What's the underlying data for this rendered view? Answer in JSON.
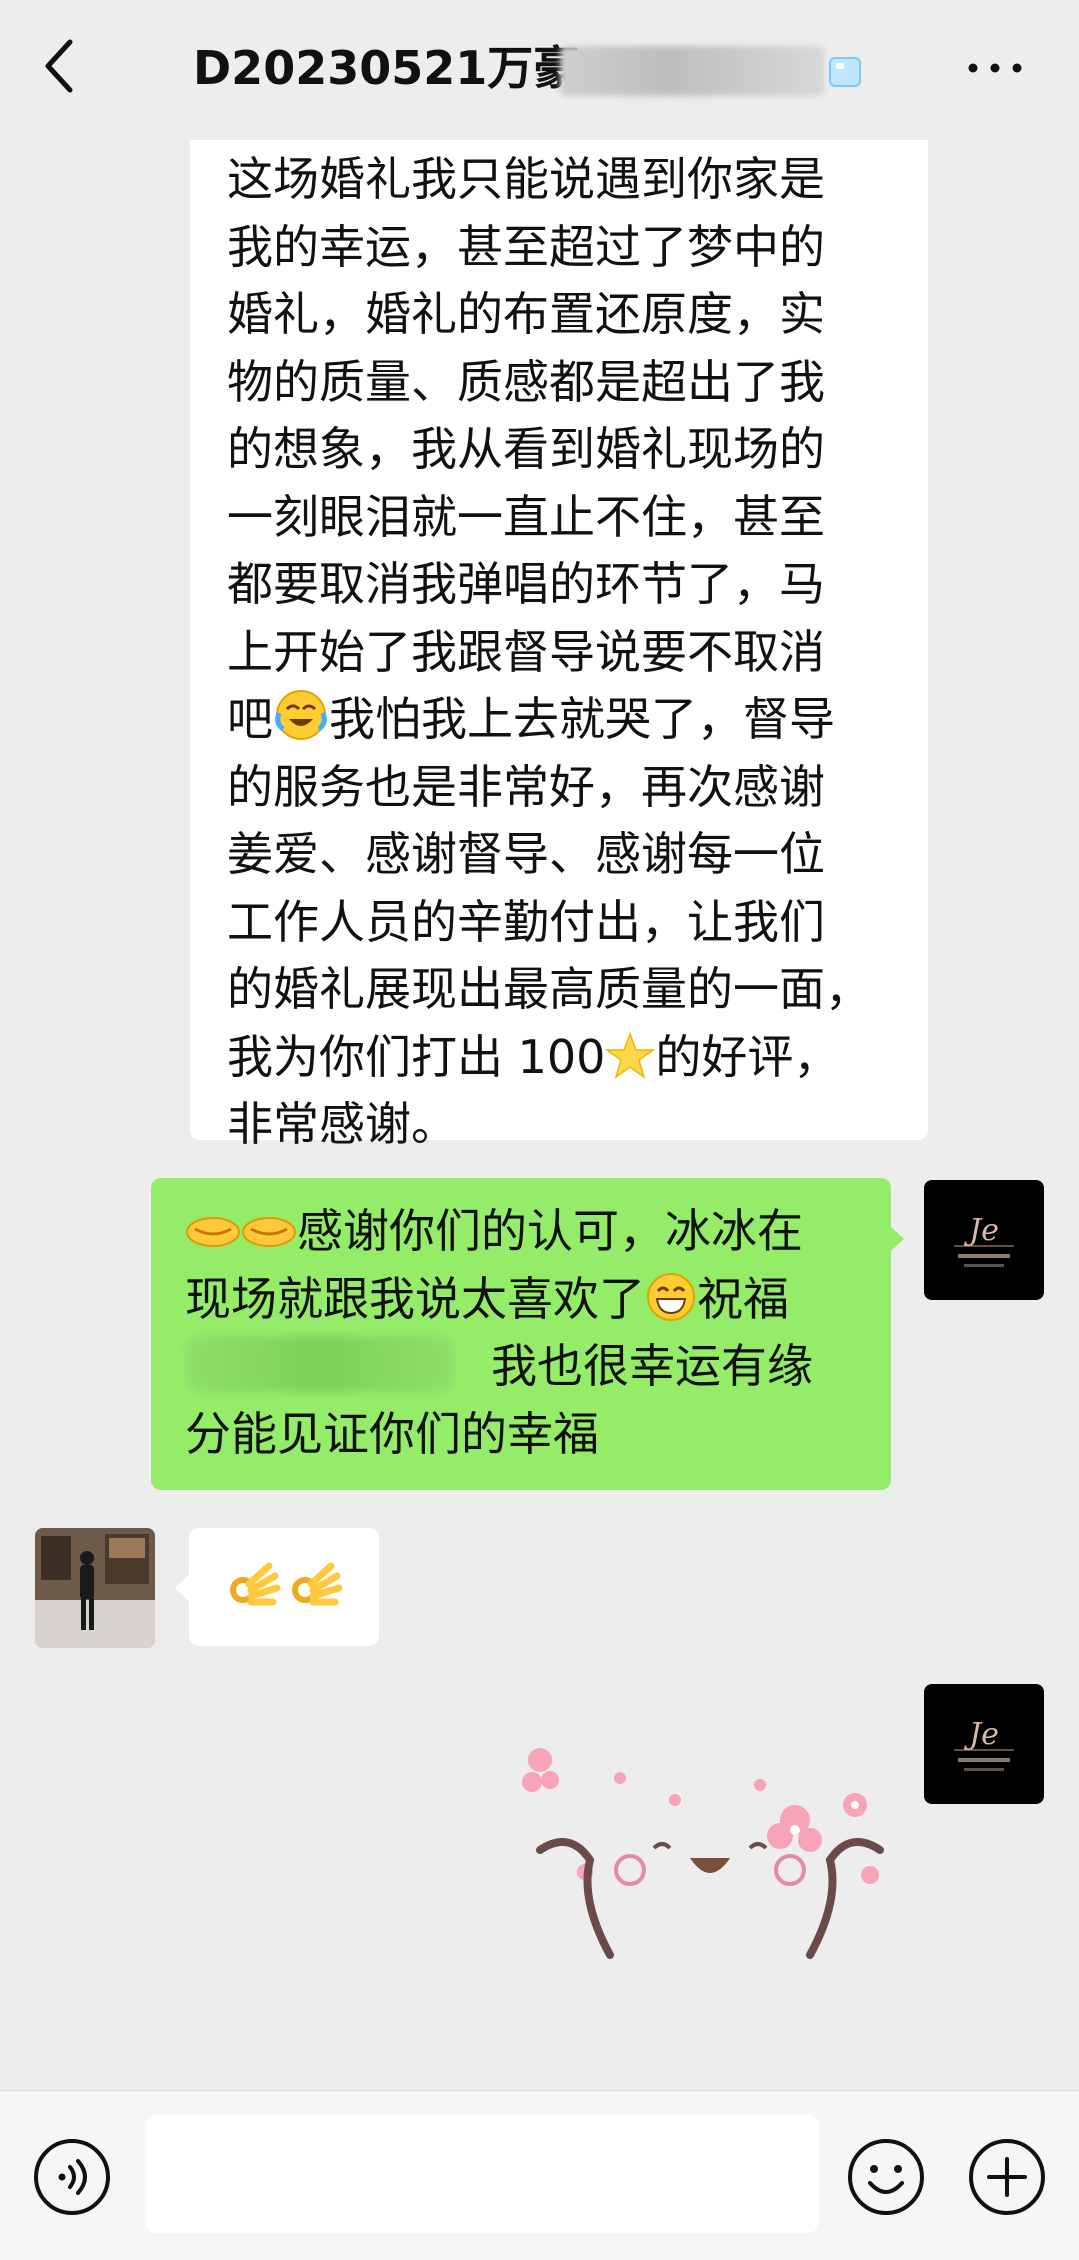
{
  "header": {
    "title": "D20230521万豪",
    "back_icon": "chevron-left-icon",
    "more_icon": "more-dots-icon",
    "title_emoji": "ice-cube-icon"
  },
  "messages": {
    "m1": {
      "lines": [
        "这场婚礼我只能说遇到你家是",
        "我的幸运，甚至超过了梦中的",
        "婚礼，婚礼的布置还原度，实",
        "物的质量、质感都是超出了我",
        "的想象，我从看到婚礼现场的",
        "一刻眼泪就一直止不住，甚至",
        "都要取消我弹唱的环节了，马",
        "上开始了我跟督导说要不取消"
      ],
      "l9a": "吧",
      "l9b": "我怕我上去就哭了，督导",
      "lines2": [
        "的服务也是非常好，再次感谢",
        "姜爱、感谢督导、感谢每一位",
        "工作人员的辛勤付出，让我们",
        "的婚礼展现出最高质量的一面，"
      ],
      "l14a": "我为你们打出 100",
      "l14b": "的好评，",
      "l15": "非常感谢。"
    },
    "m2": {
      "l1": "感谢你们的认可，冰冰在",
      "l2a": "现场就跟我说太喜欢了",
      "l2b": "祝福",
      "l3": "我也很幸运有缘",
      "l4": "分能见证你们的幸福"
    },
    "m3": {
      "emoji_count": "2",
      "emoji": "ok-hand-icon"
    }
  },
  "colors": {
    "background": "#ededed",
    "sent_bubble": "#95ec69",
    "received_bubble": "#ffffff"
  },
  "bottombar": {
    "voice_icon": "voice-icon",
    "emoji_icon": "smiley-icon",
    "plus_icon": "plus-circle-icon",
    "input_value": ""
  }
}
